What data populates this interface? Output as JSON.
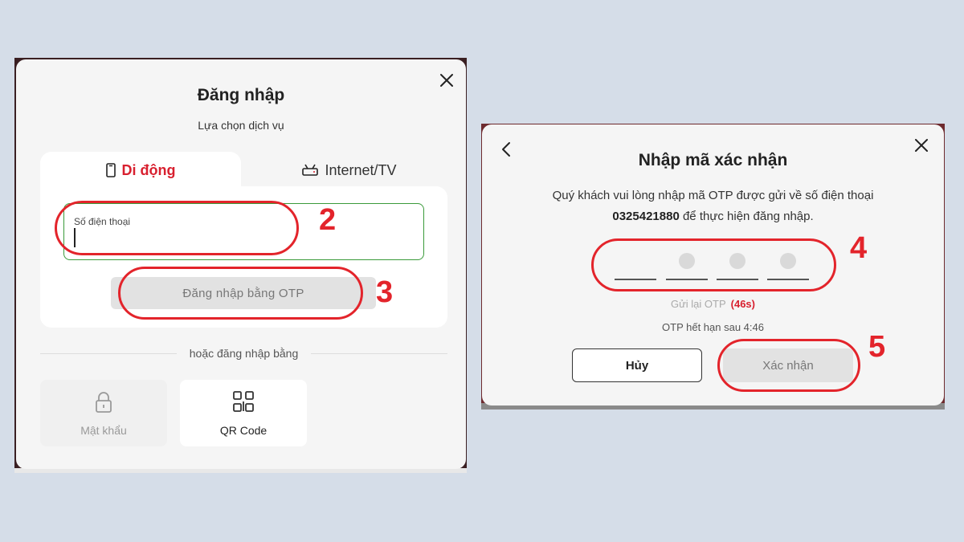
{
  "login": {
    "title": "Đăng nhập",
    "subtitle": "Lựa chọn dịch vụ",
    "tabs": [
      {
        "label": "Di động",
        "icon": "phone-icon",
        "active": true
      },
      {
        "label": "Internet/TV",
        "icon": "router-icon",
        "active": false
      }
    ],
    "phone_field": {
      "label": "Số điện thoại",
      "value": ""
    },
    "otp_button": "Đăng nhập bằng OTP",
    "divider_text": "hoặc đăng nhập bằng",
    "alt_methods": [
      {
        "label": "Mật khẩu",
        "icon": "lock-icon"
      },
      {
        "label": "QR Code",
        "icon": "qr-code-icon"
      }
    ]
  },
  "otp": {
    "title": "Nhập mã xác nhận",
    "desc_line1": "Quý khách vui lòng nhập mã OTP được gửi về số điện thoại",
    "phone_number": "0325421880",
    "desc_line2_suffix": " để thực hiện đăng nhập.",
    "digits": [
      "",
      "",
      "",
      ""
    ],
    "resend_label": "Gửi lại OTP",
    "resend_countdown": "(46s)",
    "expire_text": "OTP hết hạn sau 4:46",
    "cancel_button": "Hủy",
    "confirm_button": "Xác nhận"
  },
  "annotations": {
    "steps": [
      "2",
      "3",
      "4",
      "5"
    ]
  },
  "colors": {
    "accent_red": "#d8202f",
    "annotation_red": "#e3242b",
    "field_border_green": "#3a9a3a",
    "page_background": "#d5dde8"
  }
}
